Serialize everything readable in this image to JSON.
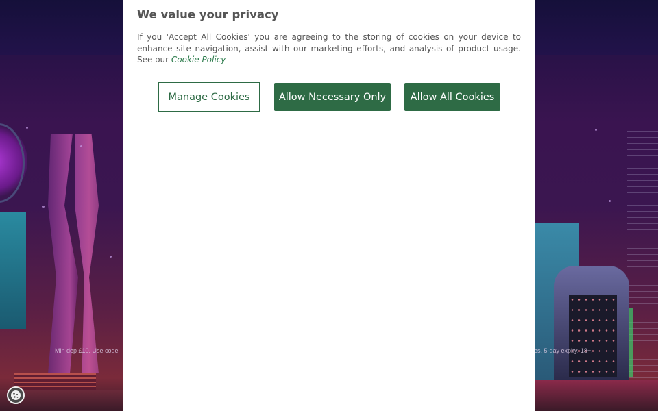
{
  "consent": {
    "title": "We value your privacy",
    "body_text": "If you 'Accept All Cookies' you are agreeing to the storing of cookies on your device to enhance site navigation, assist with our marketing efforts, and analysis of product usage. See our ",
    "policy_link": "Cookie Policy",
    "buttons": {
      "manage": "Manage Cookies",
      "necessary": "Allow Necessary Only",
      "all": "Allow All Cookies"
    },
    "colors": {
      "accent": "#2e6b45",
      "text": "#555555"
    }
  },
  "background": {
    "promo_left": "Min dep £10. Use code",
    "promo_right": "plies. 5-day expiry. 18+."
  },
  "floating": {
    "icon": "cookie-icon"
  }
}
